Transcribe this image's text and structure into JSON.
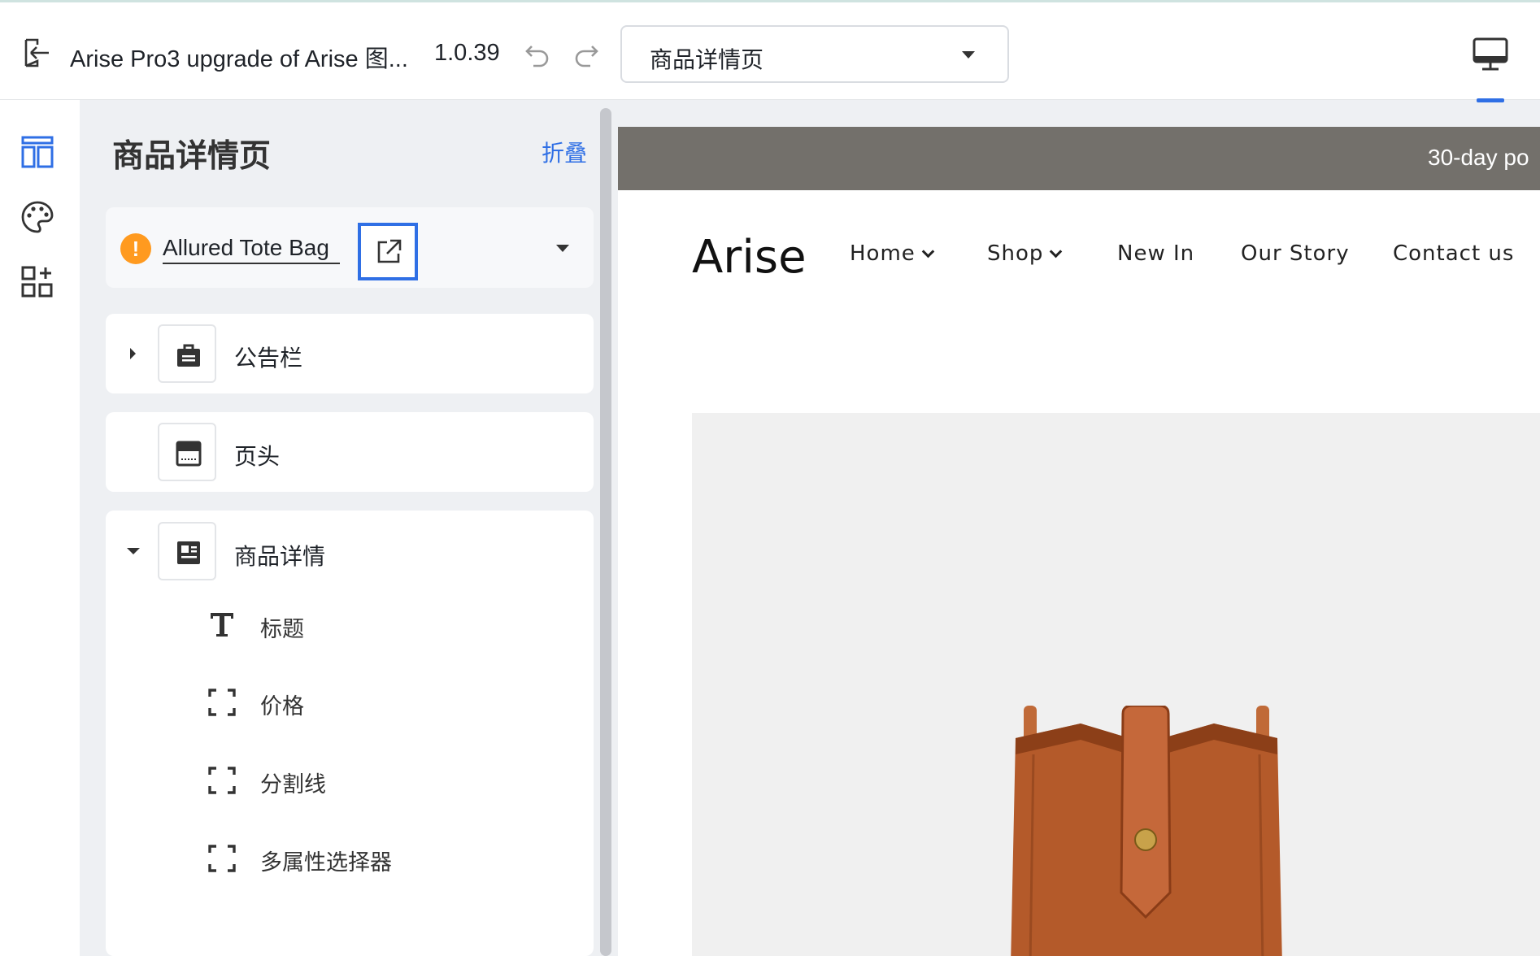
{
  "topbar": {
    "title": "Arise Pro3 upgrade of Arise 图...",
    "version": "1.0.39",
    "page_select": "商品详情页"
  },
  "panel": {
    "title": "商品详情页",
    "collapse": "折叠",
    "product": {
      "name": "Allured Tote Bag",
      "warning_symbol": "!"
    },
    "sections": [
      {
        "label": "公告栏",
        "icon": "bag-icon"
      },
      {
        "label": "页头",
        "icon": "header-icon"
      },
      {
        "label": "商品详情",
        "icon": "product-detail-icon"
      }
    ],
    "children": [
      {
        "label": "标题",
        "icon": "text-icon"
      },
      {
        "label": "价格",
        "icon": "block-icon"
      },
      {
        "label": "分割线",
        "icon": "block-icon"
      },
      {
        "label": "多属性选择器",
        "icon": "block-icon"
      }
    ]
  },
  "preview": {
    "announcement": "30-day po",
    "brand": "Arise",
    "nav": [
      {
        "label": "Home",
        "has_dropdown": true
      },
      {
        "label": "Shop",
        "has_dropdown": true
      },
      {
        "label": "New In",
        "has_dropdown": false
      },
      {
        "label": "Our Story",
        "has_dropdown": false
      },
      {
        "label": "Contact us",
        "has_dropdown": false
      }
    ]
  },
  "colors": {
    "accent": "#2f6fe5",
    "warning": "#ff9a1f",
    "announcement_bg": "#73706b",
    "bag_leather": "#b05a2d"
  }
}
